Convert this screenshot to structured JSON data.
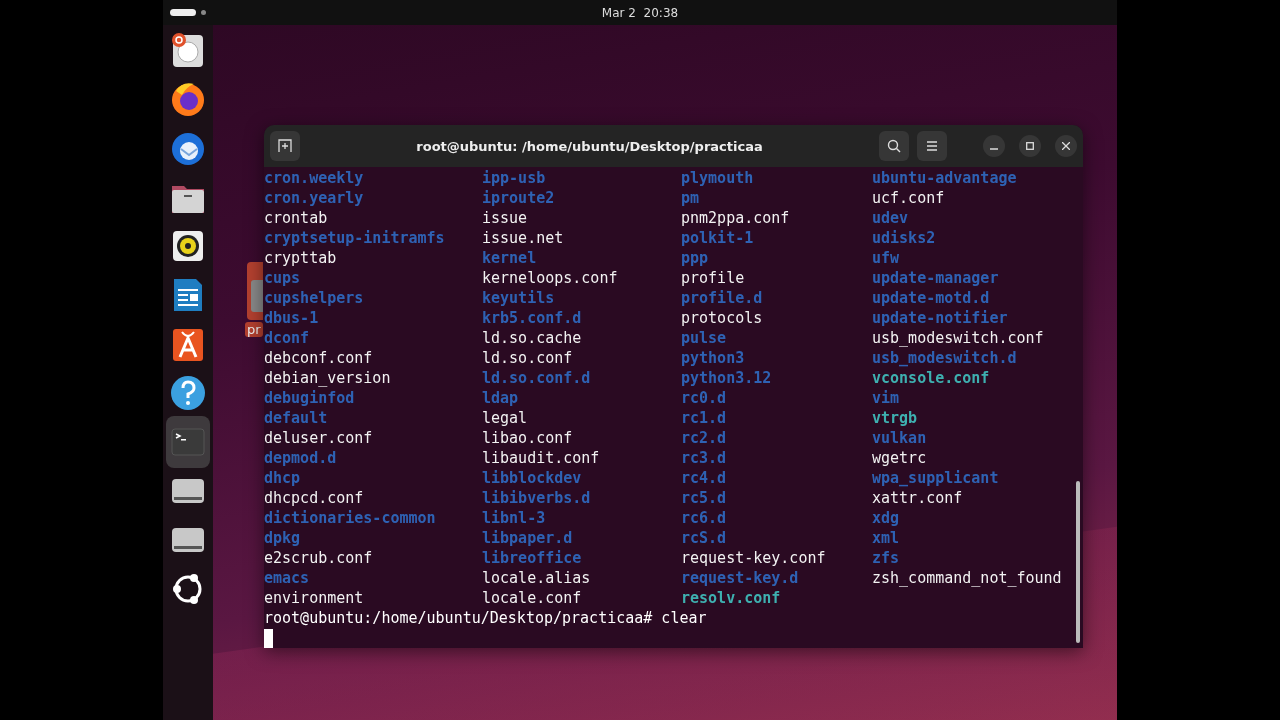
{
  "top_bar": {
    "clock": "Mar 2  20:38"
  },
  "dock": {
    "items": [
      {
        "kind": "installer",
        "selected": false
      },
      {
        "kind": "browser",
        "selected": false
      },
      {
        "kind": "mail",
        "selected": false
      },
      {
        "kind": "files",
        "selected": false
      },
      {
        "kind": "music",
        "selected": false
      },
      {
        "kind": "writer",
        "selected": false
      },
      {
        "kind": "store",
        "selected": false
      },
      {
        "kind": "help",
        "selected": false
      },
      {
        "kind": "terminal",
        "selected": true
      },
      {
        "kind": "drive",
        "selected": false
      },
      {
        "kind": "drive",
        "selected": false
      },
      {
        "kind": "apps",
        "selected": false
      }
    ]
  },
  "desktop_icons": [
    {
      "label": "pr"
    }
  ],
  "terminal": {
    "title": "root@ubuntu: /home/ubuntu/Desktop/practicaa",
    "columns": [
      [
        {
          "name": "cron.weekly",
          "kind": "dir"
        },
        {
          "name": "cron.yearly",
          "kind": "dir"
        },
        {
          "name": "crontab",
          "kind": "file"
        },
        {
          "name": "cryptsetup-initramfs",
          "kind": "dir"
        },
        {
          "name": "crypttab",
          "kind": "file"
        },
        {
          "name": "cups",
          "kind": "dir"
        },
        {
          "name": "cupshelpers",
          "kind": "dir"
        },
        {
          "name": "dbus-1",
          "kind": "dir"
        },
        {
          "name": "dconf",
          "kind": "dir"
        },
        {
          "name": "debconf.conf",
          "kind": "file"
        },
        {
          "name": "debian_version",
          "kind": "file"
        },
        {
          "name": "debuginfod",
          "kind": "dir"
        },
        {
          "name": "default",
          "kind": "dir"
        },
        {
          "name": "deluser.conf",
          "kind": "file"
        },
        {
          "name": "depmod.d",
          "kind": "dir"
        },
        {
          "name": "dhcp",
          "kind": "dir"
        },
        {
          "name": "dhcpcd.conf",
          "kind": "file"
        },
        {
          "name": "dictionaries-common",
          "kind": "dir"
        },
        {
          "name": "dpkg",
          "kind": "dir"
        },
        {
          "name": "e2scrub.conf",
          "kind": "file"
        },
        {
          "name": "emacs",
          "kind": "dir"
        },
        {
          "name": "environment",
          "kind": "file"
        }
      ],
      [
        {
          "name": "ipp-usb",
          "kind": "dir"
        },
        {
          "name": "iproute2",
          "kind": "dir"
        },
        {
          "name": "issue",
          "kind": "file"
        },
        {
          "name": "issue.net",
          "kind": "file"
        },
        {
          "name": "kernel",
          "kind": "dir"
        },
        {
          "name": "kerneloops.conf",
          "kind": "file"
        },
        {
          "name": "keyutils",
          "kind": "dir"
        },
        {
          "name": "krb5.conf.d",
          "kind": "dir"
        },
        {
          "name": "ld.so.cache",
          "kind": "file"
        },
        {
          "name": "ld.so.conf",
          "kind": "file"
        },
        {
          "name": "ld.so.conf.d",
          "kind": "dir"
        },
        {
          "name": "ldap",
          "kind": "dir"
        },
        {
          "name": "legal",
          "kind": "file"
        },
        {
          "name": "libao.conf",
          "kind": "file"
        },
        {
          "name": "libaudit.conf",
          "kind": "file"
        },
        {
          "name": "libblockdev",
          "kind": "dir"
        },
        {
          "name": "libibverbs.d",
          "kind": "dir"
        },
        {
          "name": "libnl-3",
          "kind": "dir"
        },
        {
          "name": "libpaper.d",
          "kind": "dir"
        },
        {
          "name": "libreoffice",
          "kind": "dir"
        },
        {
          "name": "locale.alias",
          "kind": "file"
        },
        {
          "name": "locale.conf",
          "kind": "file"
        }
      ],
      [
        {
          "name": "plymouth",
          "kind": "dir"
        },
        {
          "name": "pm",
          "kind": "dir"
        },
        {
          "name": "pnm2ppa.conf",
          "kind": "file"
        },
        {
          "name": "polkit-1",
          "kind": "dir"
        },
        {
          "name": "ppp",
          "kind": "dir"
        },
        {
          "name": "profile",
          "kind": "file"
        },
        {
          "name": "profile.d",
          "kind": "dir"
        },
        {
          "name": "protocols",
          "kind": "file"
        },
        {
          "name": "pulse",
          "kind": "dir"
        },
        {
          "name": "python3",
          "kind": "dir"
        },
        {
          "name": "python3.12",
          "kind": "dir"
        },
        {
          "name": "rc0.d",
          "kind": "dir"
        },
        {
          "name": "rc1.d",
          "kind": "dir"
        },
        {
          "name": "rc2.d",
          "kind": "dir"
        },
        {
          "name": "rc3.d",
          "kind": "dir"
        },
        {
          "name": "rc4.d",
          "kind": "dir"
        },
        {
          "name": "rc5.d",
          "kind": "dir"
        },
        {
          "name": "rc6.d",
          "kind": "dir"
        },
        {
          "name": "rcS.d",
          "kind": "dir"
        },
        {
          "name": "request-key.conf",
          "kind": "file"
        },
        {
          "name": "request-key.d",
          "kind": "dir"
        },
        {
          "name": "resolv.conf",
          "kind": "link"
        }
      ],
      [
        {
          "name": "ubuntu-advantage",
          "kind": "dir"
        },
        {
          "name": "ucf.conf",
          "kind": "file"
        },
        {
          "name": "udev",
          "kind": "dir"
        },
        {
          "name": "udisks2",
          "kind": "dir"
        },
        {
          "name": "ufw",
          "kind": "dir"
        },
        {
          "name": "update-manager",
          "kind": "dir"
        },
        {
          "name": "update-motd.d",
          "kind": "dir"
        },
        {
          "name": "update-notifier",
          "kind": "dir"
        },
        {
          "name": "usb_modeswitch.conf",
          "kind": "file"
        },
        {
          "name": "usb_modeswitch.d",
          "kind": "dir"
        },
        {
          "name": "vconsole.conf",
          "kind": "link"
        },
        {
          "name": "vim",
          "kind": "dir"
        },
        {
          "name": "vtrgb",
          "kind": "link"
        },
        {
          "name": "vulkan",
          "kind": "dir"
        },
        {
          "name": "wgetrc",
          "kind": "file"
        },
        {
          "name": "wpa_supplicant",
          "kind": "dir"
        },
        {
          "name": "xattr.conf",
          "kind": "file"
        },
        {
          "name": "xdg",
          "kind": "dir"
        },
        {
          "name": "xml",
          "kind": "dir"
        },
        {
          "name": "zfs",
          "kind": "dir"
        },
        {
          "name": "zsh_command_not_found",
          "kind": "file"
        }
      ]
    ],
    "prompt": "root@ubuntu:/home/ubuntu/Desktop/practicaa# clear"
  }
}
